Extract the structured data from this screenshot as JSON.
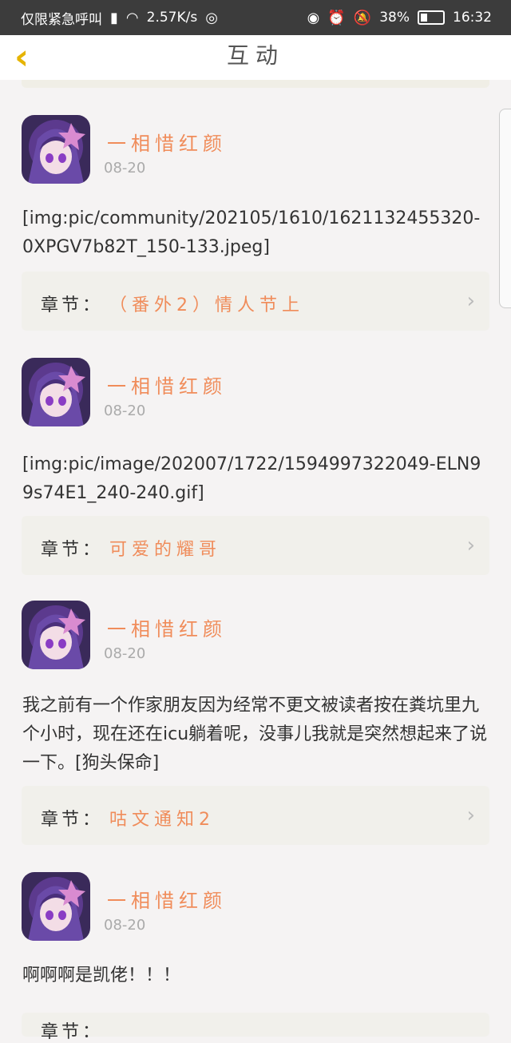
{
  "status": {
    "carrier": "仅限紧急呼叫",
    "speed": "2.57K/s",
    "battery": "38%",
    "time": "16:32"
  },
  "header": {
    "title": "互动",
    "back_icon": "chevron-left-icon"
  },
  "posts": [
    {
      "user": "一相惜红颜",
      "date": "08-20",
      "content": "[img:pic/community/202105/1610/1621132455320-0XPGV7b82T_150-133.jpeg]",
      "chapter_label": "章节：",
      "chapter_title": "（番外2）情人节上"
    },
    {
      "user": "一相惜红颜",
      "date": "08-20",
      "content": "[img:pic/image/202007/1722/1594997322049-ELN99s74E1_240-240.gif]",
      "chapter_label": "章节：",
      "chapter_title": "可爱的耀哥"
    },
    {
      "user": "一相惜红颜",
      "date": "08-20",
      "content": "我之前有一个作家朋友因为经常不更文被读者按在粪坑里九个小时，现在还在icu躺着呢，没事儿我就是突然想起来了说一下。[狗头保命]",
      "chapter_label": "章节：",
      "chapter_title": "咕文通知2"
    },
    {
      "user": "一相惜红颜",
      "date": "08-20",
      "content": "啊啊啊是凯佬！！！",
      "chapter_label": "章节：",
      "chapter_title": ""
    }
  ],
  "colors": {
    "accent": "#f08c5a",
    "back": "#e6b400",
    "statusbar": "#3c3c3c"
  }
}
